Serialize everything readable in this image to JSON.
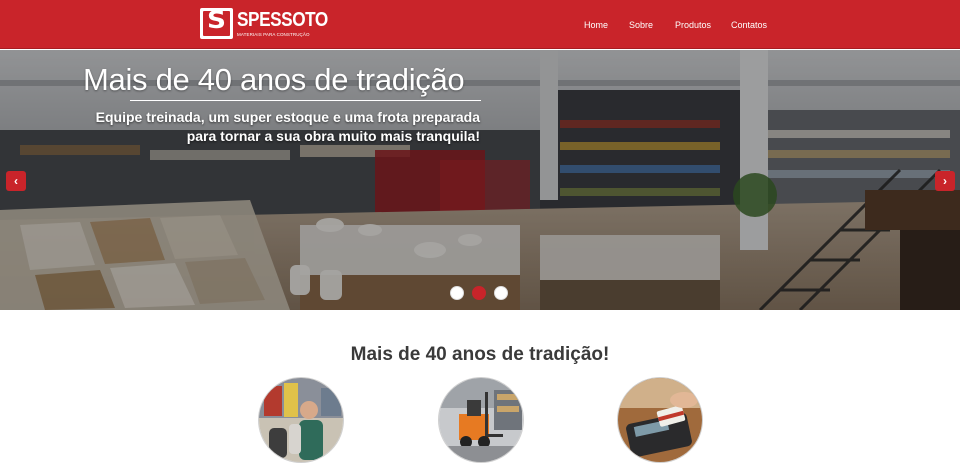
{
  "brand": {
    "name": "SPESSOTO",
    "tagline": "MATERIAIS PARA CONSTRUÇÃO",
    "color": "#c9242a"
  },
  "nav": {
    "items": [
      "Home",
      "Sobre",
      "Produtos",
      "Contatos"
    ]
  },
  "hero": {
    "title": "Mais de 40 anos de tradição",
    "subtitle_line1": "Equipe treinada, um super estoque e uma frota preparada",
    "subtitle_line2": "para tornar a sua obra muito mais tranquila!",
    "prev_icon": "chevron-left-icon",
    "next_icon": "chevron-right-icon",
    "slides_total": 3,
    "active_slide": 2
  },
  "section": {
    "title": "Mais de 40 anos de tradição!"
  },
  "features": [
    {
      "icon": "staff-photo"
    },
    {
      "icon": "forklift-photo"
    },
    {
      "icon": "card-terminal-photo"
    }
  ]
}
